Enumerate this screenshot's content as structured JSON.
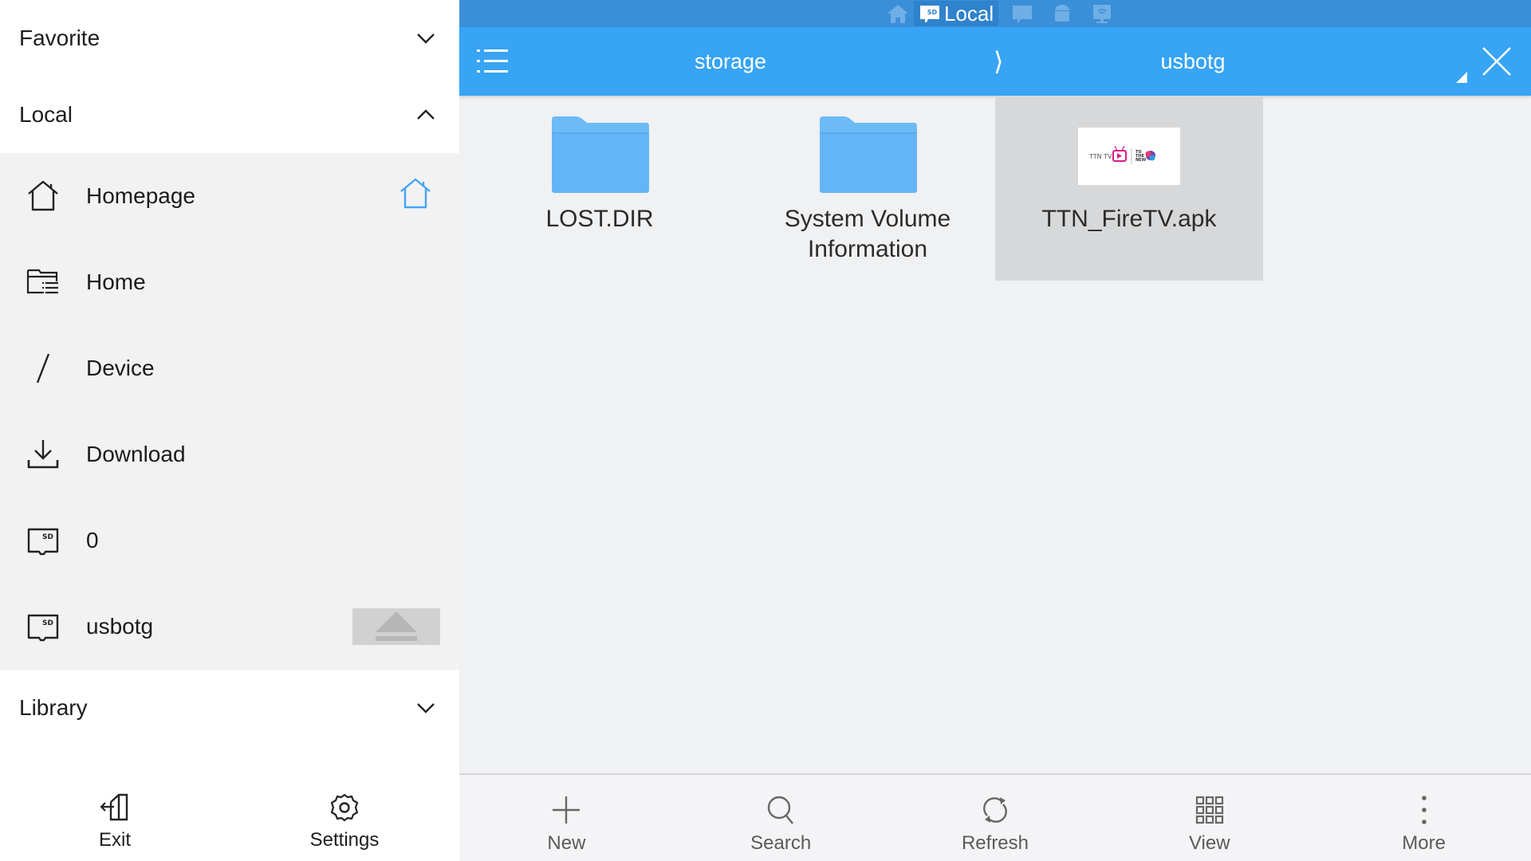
{
  "sidebar": {
    "sections": {
      "favorite": {
        "label": "Favorite",
        "state": "collapsed"
      },
      "local": {
        "label": "Local",
        "state": "expanded"
      },
      "library": {
        "label": "Library",
        "state": "collapsed"
      }
    },
    "local_items": [
      {
        "label": "Homepage",
        "icon": "home-icon"
      },
      {
        "label": "Home",
        "icon": "folder-list-icon"
      },
      {
        "label": "Device",
        "icon": "slash-icon"
      },
      {
        "label": "Download",
        "icon": "download-icon"
      },
      {
        "label": "0",
        "icon": "sd-card-icon"
      },
      {
        "label": "usbotg",
        "icon": "sd-card-icon"
      }
    ],
    "footer": {
      "exit_label": "Exit",
      "settings_label": "Settings"
    }
  },
  "topbar": {
    "tabs": [
      {
        "icon": "home-icon",
        "label": ""
      },
      {
        "icon": "sd-card-icon",
        "label": "Local",
        "active": true
      },
      {
        "icon": "sd-card-icon",
        "label": ""
      },
      {
        "icon": "android-icon",
        "label": ""
      },
      {
        "icon": "network-icon",
        "label": ""
      }
    ]
  },
  "header": {
    "breadcrumb": [
      "storage",
      "usbotg"
    ],
    "separator": "⟩"
  },
  "files": [
    {
      "name": "LOST.DIR",
      "type": "folder",
      "selected": false
    },
    {
      "name": "System Volume Information",
      "type": "folder",
      "selected": false
    },
    {
      "name": "TTN_FireTV.apk",
      "type": "apk",
      "selected": true,
      "thumb_text": "TTN TV | TO THE NEW"
    }
  ],
  "toolbar": {
    "new_label": "New",
    "search_label": "Search",
    "refresh_label": "Refresh",
    "view_label": "View",
    "more_label": "More"
  },
  "colors": {
    "accent": "#37a4f4",
    "topbar": "#3a8fd8",
    "folder": "#64b5f6",
    "selected_bg": "#d7d8da"
  }
}
